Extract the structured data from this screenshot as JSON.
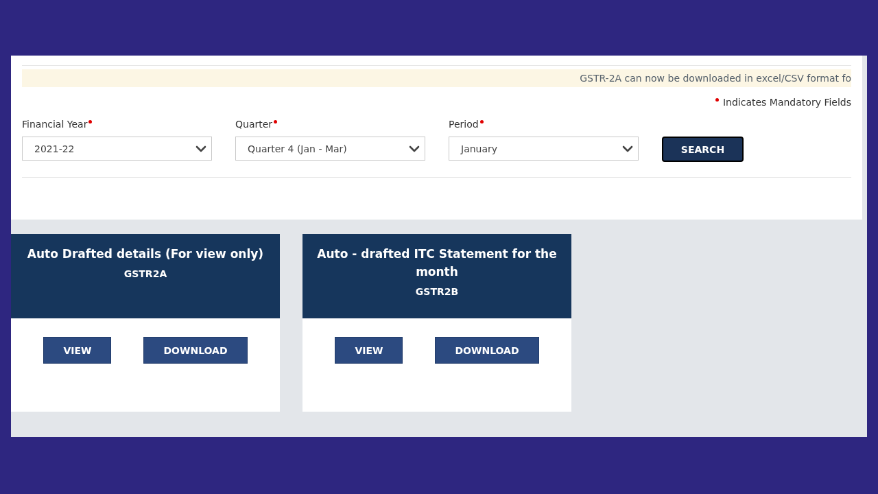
{
  "notice": "GSTR-2A can now be downloaded in excel/CSV format fo",
  "mandatory_note": "Indicates Mandatory Fields",
  "filters": [
    {
      "label": "Financial Year",
      "required": true,
      "value": "2021-22"
    },
    {
      "label": "Quarter",
      "required": true,
      "value": "Quarter 4 (Jan - Mar)"
    },
    {
      "label": "Period",
      "required": true,
      "value": "January"
    }
  ],
  "search_button": {
    "label": "SEARCH",
    "focused": true
  },
  "cards": [
    {
      "title": "Auto Drafted details (For view only)",
      "subtitle": "GSTR2A",
      "buttons": [
        "VIEW",
        "DOWNLOAD"
      ]
    },
    {
      "title": "Auto - drafted ITC Statement for the month",
      "subtitle": "GSTR2B",
      "buttons": [
        "VIEW",
        "DOWNLOAD"
      ]
    }
  ]
}
